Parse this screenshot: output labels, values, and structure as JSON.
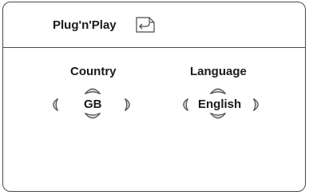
{
  "header": {
    "title": "Plug'n'Play",
    "icon": "return-menu-icon"
  },
  "country": {
    "label": "Country",
    "value": "GB"
  },
  "language": {
    "label": "Language",
    "value": "English"
  },
  "colors": {
    "frame": "#4a4a4a",
    "arrow_fill": "#d8d8d8",
    "text": "#1a1a1a"
  }
}
